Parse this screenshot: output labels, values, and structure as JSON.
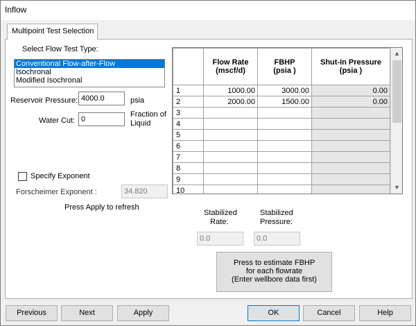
{
  "window": {
    "title": "Inflow"
  },
  "tab": {
    "label": "Multipoint Test Selection"
  },
  "flow_test": {
    "label": "Select Flow Test Type:",
    "options": [
      "Conventional Flow-after-Flow",
      "Isochronal",
      "Modified Isochronal"
    ],
    "selected": "Conventional Flow-after-Flow"
  },
  "reservoir_pressure": {
    "label": "Reservoir Pressure:",
    "value": "4000.0",
    "unit": "psia"
  },
  "water_cut": {
    "label": "Water Cut:",
    "value": "0",
    "unit_line1": "Fraction of",
    "unit_line2": "Liquid"
  },
  "specify_exponent": {
    "label": "Specify Exponent",
    "checked": false
  },
  "forscheimer": {
    "label": "Forscheimer Exponent :",
    "value": "34.820"
  },
  "refresh_hint": "Press Apply to refresh",
  "grid": {
    "headers": {
      "flow_rate_1": "Flow Rate",
      "flow_rate_2": "(mscf/d)",
      "fbhp_1": "FBHP",
      "fbhp_2": "(psia )",
      "shut_1": "Shut-In Pressure",
      "shut_2": "(psia )"
    },
    "rows": [
      {
        "n": "1",
        "rate": "1000.00",
        "fbhp": "3000.00",
        "shut": "0.00"
      },
      {
        "n": "2",
        "rate": "2000.00",
        "fbhp": "1500.00",
        "shut": "0.00"
      },
      {
        "n": "3",
        "rate": "",
        "fbhp": "",
        "shut": ""
      },
      {
        "n": "4",
        "rate": "",
        "fbhp": "",
        "shut": ""
      },
      {
        "n": "5",
        "rate": "",
        "fbhp": "",
        "shut": ""
      },
      {
        "n": "6",
        "rate": "",
        "fbhp": "",
        "shut": ""
      },
      {
        "n": "7",
        "rate": "",
        "fbhp": "",
        "shut": ""
      },
      {
        "n": "8",
        "rate": "",
        "fbhp": "",
        "shut": ""
      },
      {
        "n": "9",
        "rate": "",
        "fbhp": "",
        "shut": ""
      },
      {
        "n": "10",
        "rate": "",
        "fbhp": "",
        "shut": ""
      }
    ],
    "scroll_up_icon": "triangle-up",
    "scroll_down_icon": "triangle-down"
  },
  "stabilized": {
    "rate_label_1": "Stabilized",
    "rate_label_2": "Rate:",
    "rate_value": "0.0",
    "pressure_label_1": "Stabilized",
    "pressure_label_2": "Pressure:",
    "pressure_value": "0.0"
  },
  "estimate_button": {
    "line1": "Press to estimate FBHP",
    "line2": "for each flowrate",
    "line3": "(Enter wellbore data first)"
  },
  "footer": {
    "previous": "Previous",
    "next": "Next",
    "apply": "Apply",
    "ok": "OK",
    "cancel": "Cancel",
    "help": "Help"
  }
}
